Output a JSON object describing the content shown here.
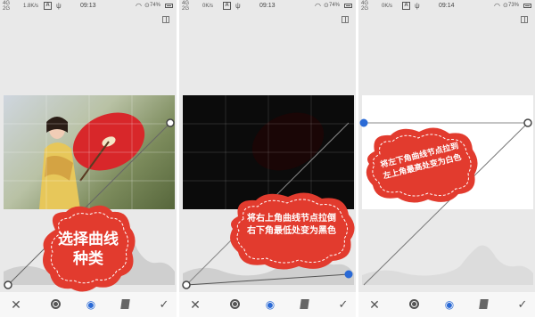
{
  "colors": {
    "accent_blue": "#2a6ad6",
    "bubble_red": "#e23b2e",
    "panel_bg": "#e9e9e9"
  },
  "panels": [
    {
      "status": {
        "carrier": "4G\n2G",
        "speed": "1.8K/s",
        "notif": "A",
        "time": "09:13",
        "battery": "74%"
      },
      "bubble_text": "选择曲线\n种类",
      "toolbar": [
        "close-icon",
        "adjust-icon",
        "eye-icon",
        "style-icon",
        "check-icon"
      ]
    },
    {
      "status": {
        "carrier": "4G\n2G",
        "speed": "0K/s",
        "notif": "A",
        "time": "09:13",
        "battery": "74%"
      },
      "bubble_text": "将右上角曲线节点拉倒\n右下角最低处变为黑色",
      "toolbar": [
        "close-icon",
        "adjust-icon",
        "eye-icon",
        "style-icon",
        "check-icon"
      ]
    },
    {
      "status": {
        "carrier": "4G\n2G",
        "speed": "0K/s",
        "notif": "A",
        "time": "09:14",
        "battery": "73%"
      },
      "bubble_text": "将左下角曲线节点拉到\n左上角最高处变为白色",
      "toolbar": [
        "close-icon",
        "adjust-icon",
        "eye-icon",
        "style-icon",
        "check-icon"
      ]
    }
  ]
}
